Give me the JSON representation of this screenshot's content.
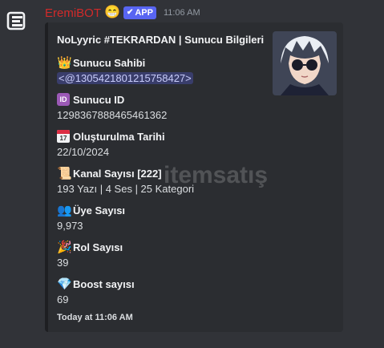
{
  "message": {
    "username": "EremiBOT",
    "face_emoji": "😁",
    "app_badge": "APP",
    "app_badge_check": "✔",
    "timestamp": "11:06 AM"
  },
  "embed": {
    "title": "NoLyyric #TEKRARDAN | Sunucu Bilgileri",
    "fields": [
      {
        "icon": "👑",
        "name": "Sunucu Sahibi",
        "value": "<@1305421801215758427>"
      },
      {
        "icon": "ID",
        "name": "Sunucu ID",
        "value": "1298367888465461362"
      },
      {
        "icon": "17",
        "name": "Oluşturulma Tarihi",
        "value": "22/10/2024"
      },
      {
        "icon": "📜",
        "name": "Kanal Sayısı [222]",
        "value": "193 Yazı | 4 Ses | 25 Kategori"
      },
      {
        "icon": "👥",
        "name": "Üye Sayısı",
        "value": "9,973"
      },
      {
        "icon": "🎉",
        "name": "Rol Sayısı",
        "value": "39"
      },
      {
        "icon": "💎",
        "name": "Boost sayısı",
        "value": "69"
      }
    ],
    "footer": "Today at 11:06 AM"
  },
  "watermark": "itemsatış",
  "colors": {
    "background": "#313338",
    "embed_bg": "#2b2d31",
    "username": "#d12a2a",
    "app_badge": "#5865f2",
    "mention_bg": "#3c4270"
  }
}
